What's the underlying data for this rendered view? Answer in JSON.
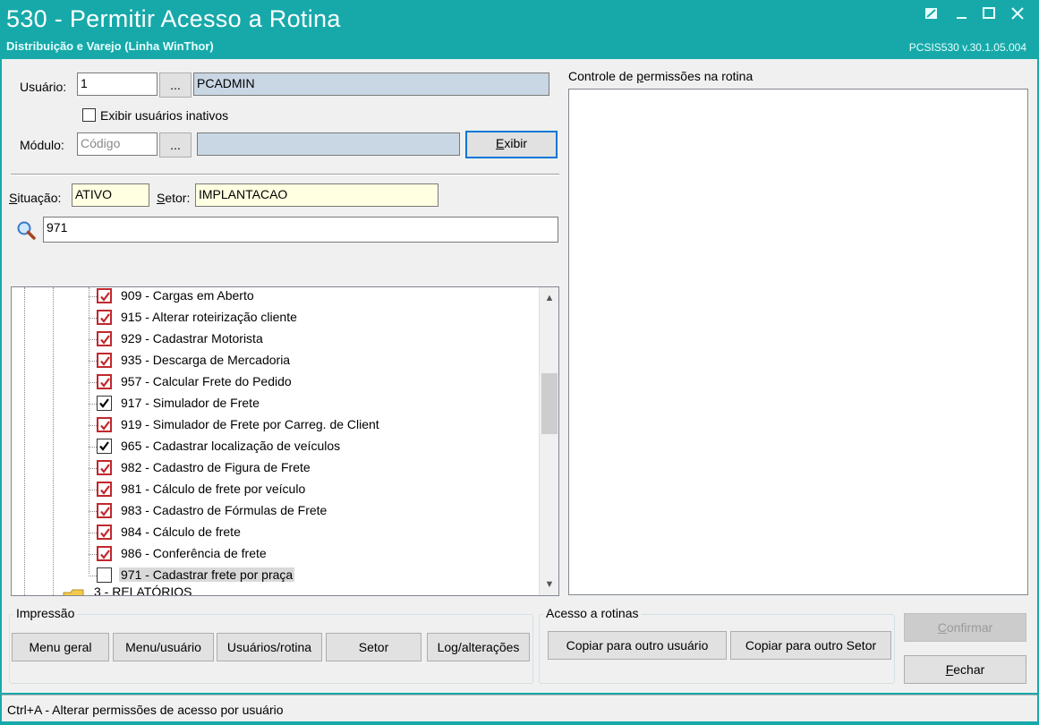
{
  "window": {
    "title": "530 - Permitir Acesso a Rotina",
    "subtitle": "Distribuição e Varejo (Linha WinThor)",
    "version": "PCSIS530  v.30.1.05.004"
  },
  "form": {
    "usuario_label": "Usuário:",
    "usuario_code": "1",
    "browse_label": "...",
    "usuario_name": "PCADMIN",
    "inativos_label": "Exibir usuários inativos",
    "modulo_label": "Módulo:",
    "modulo_placeholder": "Código",
    "modulo_name": "",
    "exibir_label": "Exibir",
    "situacao_label": "Situação:",
    "situacao_value": "ATIVO",
    "setor_label": "Setor:",
    "setor_value": "IMPLANTACAO",
    "search_value": "971"
  },
  "tree": {
    "items": [
      {
        "label": "909 - Cargas em Aberto",
        "checked": true,
        "style": "red"
      },
      {
        "label": "915 - Alterar roteirização cliente",
        "checked": true,
        "style": "red"
      },
      {
        "label": "929 - Cadastrar Motorista",
        "checked": true,
        "style": "red"
      },
      {
        "label": "935 - Descarga de Mercadoria",
        "checked": true,
        "style": "red"
      },
      {
        "label": "957 - Calcular Frete do Pedido",
        "checked": true,
        "style": "red"
      },
      {
        "label": "917 - Simulador de Frete",
        "checked": true,
        "style": "black"
      },
      {
        "label": "919 - Simulador de Frete por Carreg. de Client",
        "checked": true,
        "style": "red"
      },
      {
        "label": "965 - Cadastrar localização de veículos",
        "checked": true,
        "style": "black"
      },
      {
        "label": "982 - Cadastro de Figura de Frete",
        "checked": true,
        "style": "red"
      },
      {
        "label": "981 - Cálculo de frete por veículo",
        "checked": true,
        "style": "red"
      },
      {
        "label": "983 - Cadastro de Fórmulas de Frete",
        "checked": true,
        "style": "red"
      },
      {
        "label": "984 - Cálculo de frete",
        "checked": true,
        "style": "red"
      },
      {
        "label": "986 - Conferência de frete",
        "checked": true,
        "style": "red"
      },
      {
        "label": "971 - Cadastrar frete por praça",
        "checked": false,
        "style": "black"
      }
    ],
    "partial_item": "3 - RELATÓRIOS"
  },
  "right_panel": {
    "title_pre": "Controle de ",
    "title_ul": "p",
    "title_post": "ermissões na rotina"
  },
  "impressao": {
    "title": "Impressão",
    "buttons": [
      "Menu geral",
      "Menu/usuário",
      "Usuários/rotina",
      "Setor",
      "Log/alterações"
    ]
  },
  "acesso": {
    "title": "Acesso a rotinas",
    "buttons": [
      "Copiar para outro usuário",
      "Copiar para outro Setor"
    ]
  },
  "actions": {
    "confirmar": "Confirmar",
    "fechar": "Fechar"
  },
  "status": {
    "text": "Ctrl+A - Alterar permissões de acesso por usuário"
  },
  "colors": {
    "title_bar": "#17a9aa",
    "check_red": "#c0282d",
    "focus_blue": "#0078d7",
    "yellow_field": "#ffffe1"
  }
}
